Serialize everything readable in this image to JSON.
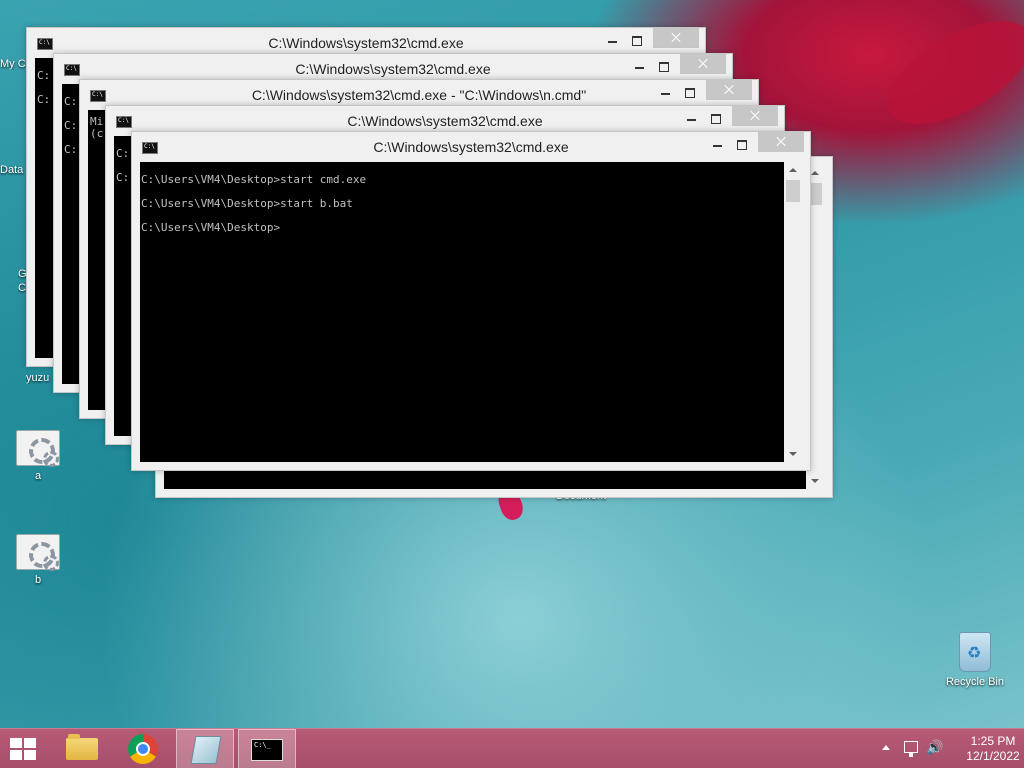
{
  "desktop": {
    "peek_labels": [
      "My C",
      "Data",
      "G",
      "C",
      "yuzu"
    ],
    "icons": [
      {
        "label": "a"
      },
      {
        "label": "b"
      },
      {
        "label": "Recycle Bin"
      }
    ],
    "hidden_text": "Document"
  },
  "windows": [
    {
      "title": "C:\\Windows\\system32\\cmd.exe",
      "lines": [
        "C:",
        "C:"
      ]
    },
    {
      "title": "C:\\Windows\\system32\\cmd.exe",
      "lines": [
        "C:",
        "C:",
        "C:"
      ]
    },
    {
      "title": "C:\\Windows\\system32\\cmd.exe - \"C:\\Windows\\n.cmd\"",
      "lines": [
        "Mi",
        "(c"
      ]
    },
    {
      "title": "C:\\Windows\\system32\\cmd.exe",
      "lines": [
        "C:",
        "C:"
      ]
    },
    {
      "title": "C:\\Windows\\system32\\cmd.exe",
      "lines": []
    },
    {
      "title": "C:\\Windows\\system32\\cmd.exe",
      "lines": [
        "C:\\Users\\VM4\\Desktop>start cmd.exe",
        "C:\\Users\\VM4\\Desktop>start b.bat",
        "C:\\Users\\VM4\\Desktop>"
      ]
    }
  ],
  "taskbar": {
    "items": [
      "start",
      "file-explorer",
      "chrome",
      "notepad",
      "cmd"
    ],
    "active": "cmd",
    "clock": {
      "time": "1:25 PM",
      "date": "12/1/2022"
    }
  },
  "colors": {
    "taskbar": "#a54f6a",
    "console_bg": "#000000",
    "console_text": "#c0c0c0",
    "close_button": "#c7c7c7"
  }
}
